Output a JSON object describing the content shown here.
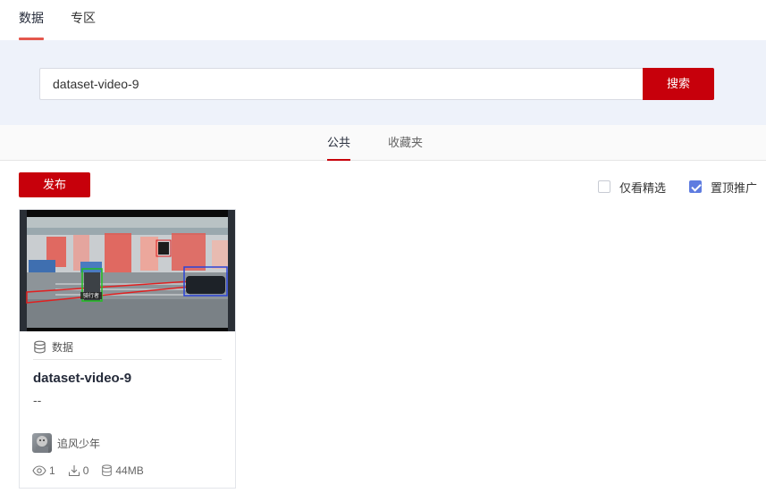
{
  "top_tabs": [
    {
      "label": "数据",
      "active": true
    },
    {
      "label": "专区",
      "active": false
    }
  ],
  "search": {
    "value": "dataset-video-9",
    "button_label": "搜索"
  },
  "sub_tabs": [
    {
      "label": "公共",
      "active": true
    },
    {
      "label": "收藏夹",
      "active": false
    }
  ],
  "toolbar": {
    "publish_label": "发布",
    "filter_featured": {
      "label": "仅看精选",
      "checked": false
    },
    "filter_pinned": {
      "label": "置顶推广",
      "checked": true
    }
  },
  "cards": [
    {
      "type_label": "数据",
      "type_icon": "database-icon",
      "title": "dataset-video-9",
      "description": "--",
      "author": "追风少年",
      "views": "1",
      "downloads": "0",
      "size": "44MB",
      "thumbnail_tag": "骑行者"
    }
  ],
  "colors": {
    "accent_red": "#c7000b",
    "tab_underline": "#e4574d",
    "checkbox_blue": "#5e7ce0",
    "search_band_bg": "#eef2fa"
  }
}
